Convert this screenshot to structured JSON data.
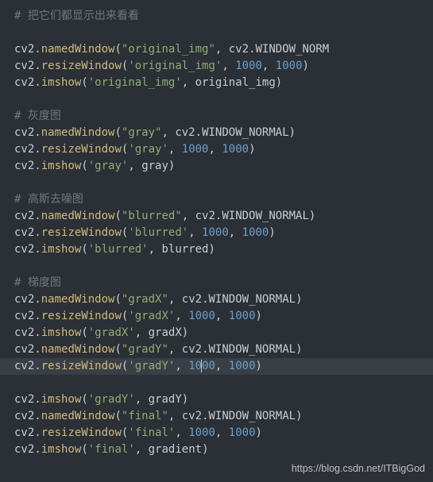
{
  "comment1": "# 把它们都显示出来看看",
  "comment2": "# 灰度图",
  "comment3": "# 高斯去噪图",
  "comment4": "# 梯度图",
  "obj": "cv2",
  "dot": ".",
  "lp": "(",
  "rp": ")",
  "comma": ", ",
  "fn": {
    "namedWindow": "namedWindow",
    "resizeWindow": "resizeWindow",
    "imshow": "imshow"
  },
  "str": {
    "original_dq": "\"original_img\"",
    "original_sq": "'original_img'",
    "gray_dq": "\"gray\"",
    "gray_sq": "'gray'",
    "blurred_dq": "\"blurred\"",
    "blurred_sq": "'blurred'",
    "gradX_dq": "\"gradX\"",
    "gradX_sq": "'gradX'",
    "gradY_dq": "\"gradY\"",
    "gradY_sq": "'gradY'",
    "final_dq": "\"final\"",
    "final_sq": "'final'"
  },
  "const": {
    "win_norm": "WINDOW_NORMAL",
    "win_norm_cut": "WINDOW_NORM"
  },
  "num": {
    "n1000": "1000",
    "n10": "10",
    "n00": "00"
  },
  "var": {
    "original_img": "original_img",
    "gray": "gray",
    "blurred": "blurred",
    "gradX": "gradX",
    "gradY": "gradY",
    "gradient": "gradient"
  },
  "watermark": "https://blog.csdn.net/ITBigGod"
}
